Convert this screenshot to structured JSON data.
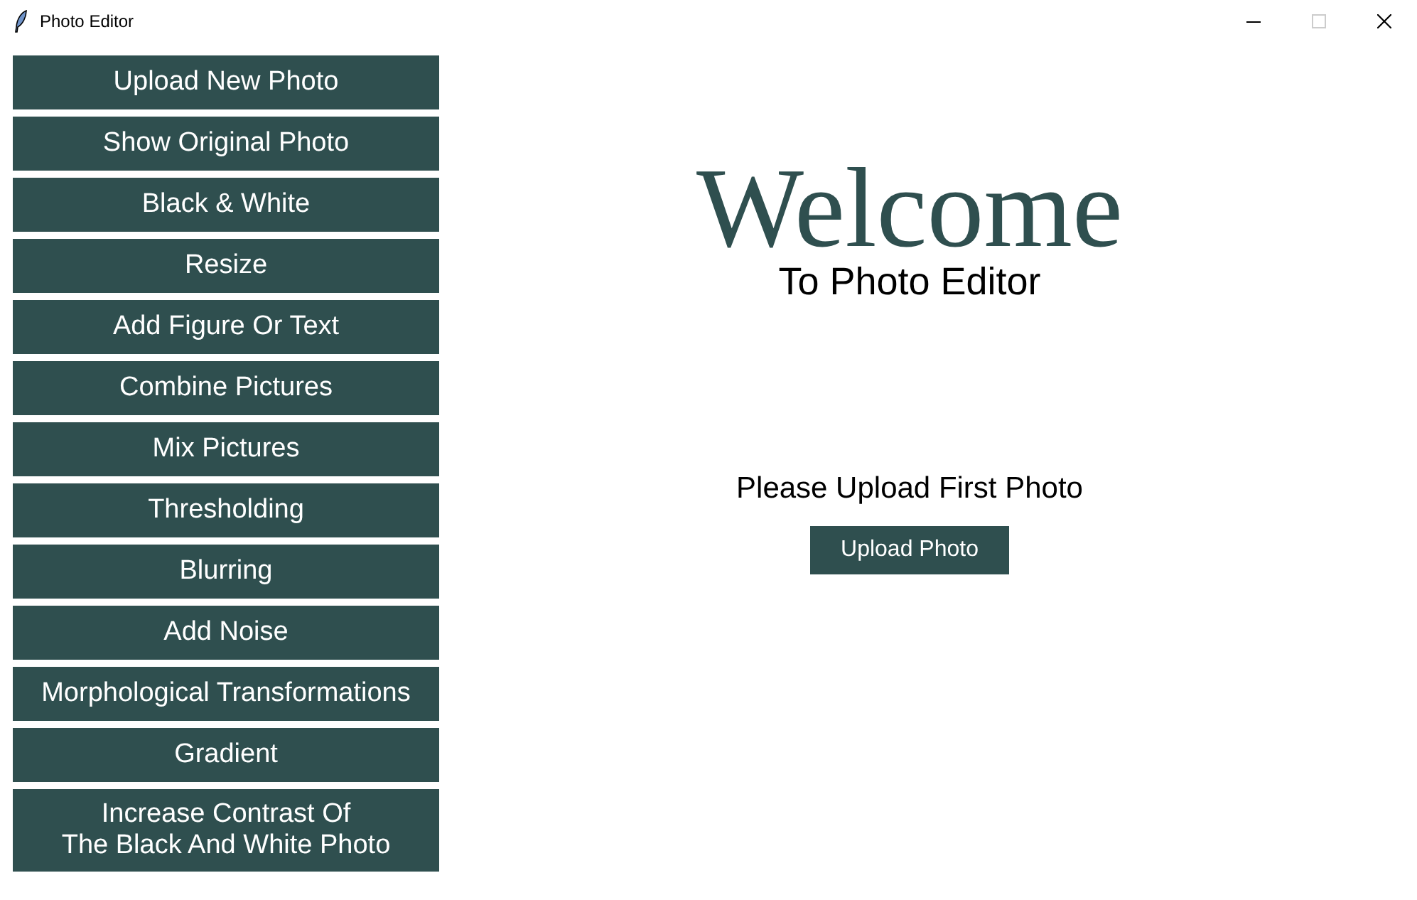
{
  "window": {
    "title": "Photo Editor",
    "controls": [
      {
        "kind": "minimize",
        "disabled": false
      },
      {
        "kind": "maximize",
        "disabled": true
      },
      {
        "kind": "close",
        "disabled": false
      }
    ]
  },
  "sidebar": {
    "buttons": [
      "Upload New Photo",
      "Show Original Photo",
      "Black & White",
      "Resize",
      "Add Figure Or Text",
      "Combine Pictures",
      "Mix Pictures",
      "Thresholding",
      "Blurring",
      "Add Noise",
      "Morphological Transformations",
      "Gradient",
      "Increase Contrast Of\nThe Black And White Photo"
    ]
  },
  "main": {
    "heading": "Welcome",
    "subheading": "To Photo Editor",
    "prompt": "Please Upload First Photo",
    "upload_button": "Upload Photo"
  }
}
